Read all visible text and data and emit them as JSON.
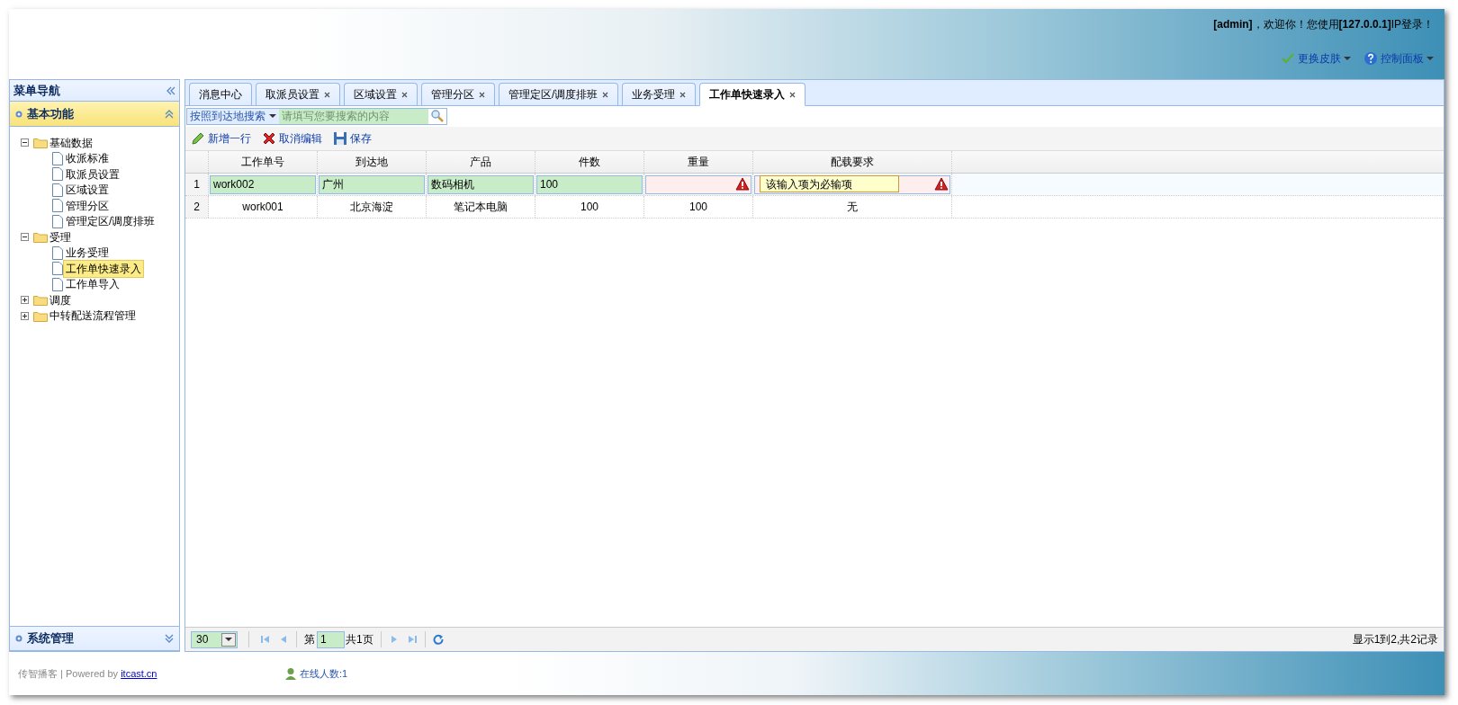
{
  "header": {
    "welcome": "**[admin]**，欢迎你！您使用**[127.0.0.1]**IP登录！",
    "menus": [
      {
        "kind": "skin",
        "label": "更换皮肤"
      },
      {
        "kind": "help",
        "label": "控制面板"
      }
    ]
  },
  "sidebar": {
    "title": "菜单导航",
    "sections": [
      {
        "title": "基本功能",
        "expanded": true,
        "tree": [
          {
            "label": "基础数据",
            "kind": "folder",
            "expanded": true,
            "children": [
              {
                "label": "收派标准",
                "kind": "file",
                "selected": false
              },
              {
                "label": "取派员设置",
                "kind": "file",
                "selected": false
              },
              {
                "label": "区域设置",
                "kind": "file",
                "selected": false
              },
              {
                "label": "管理分区",
                "kind": "file",
                "selected": false
              },
              {
                "label": "管理定区/调度排班",
                "kind": "file",
                "selected": false
              }
            ]
          },
          {
            "label": "受理",
            "kind": "folder",
            "expanded": true,
            "children": [
              {
                "label": "业务受理",
                "kind": "file",
                "selected": false
              },
              {
                "label": "工作单快速录入",
                "kind": "file",
                "selected": true
              },
              {
                "label": "工作单导入",
                "kind": "file",
                "selected": false
              }
            ]
          },
          {
            "label": "调度",
            "kind": "folder",
            "expanded": false
          },
          {
            "label": "中转配送流程管理",
            "kind": "folder",
            "expanded": false
          }
        ]
      },
      {
        "title": "系统管理",
        "expanded": false
      }
    ]
  },
  "tabs": [
    {
      "label": "消息中心",
      "closable": false,
      "selected": false
    },
    {
      "label": "取派员设置",
      "closable": true,
      "selected": false
    },
    {
      "label": "区域设置",
      "closable": true,
      "selected": false
    },
    {
      "label": "管理分区",
      "closable": true,
      "selected": false
    },
    {
      "label": "管理定区/调度排班",
      "closable": true,
      "selected": false
    },
    {
      "label": "业务受理",
      "closable": true,
      "selected": false
    },
    {
      "label": "工作单快速录入",
      "closable": true,
      "selected": true
    }
  ],
  "search": {
    "menu_label": "按照到达地搜索",
    "placeholder": "请填写您要搜索的内容"
  },
  "toolbar": [
    {
      "kind": "add",
      "label": "新增一行"
    },
    {
      "kind": "cancel",
      "label": "取消编辑"
    },
    {
      "kind": "save",
      "label": "保存"
    }
  ],
  "table": {
    "columns": [
      "工作单号",
      "到达地",
      "产品",
      "件数",
      "重量",
      "配载要求"
    ],
    "rows": [
      {
        "number": "1",
        "editing": true,
        "cells": [
          {
            "value": "work002",
            "invalid": false
          },
          {
            "value": "广州",
            "invalid": false
          },
          {
            "value": "数码相机",
            "invalid": false
          },
          {
            "value": "100",
            "invalid": false
          },
          {
            "invalid": true
          },
          {
            "invalid": true,
            "error_tip": "该输入项为必输项"
          }
        ]
      },
      {
        "number": "2",
        "editing": false,
        "cells": [
          {
            "value": "work001"
          },
          {
            "value": "北京海淀"
          },
          {
            "value": "笔记本电脑"
          },
          {
            "value": "100"
          },
          {
            "value": "100"
          },
          {
            "value": "无"
          }
        ]
      }
    ]
  },
  "pager": {
    "page_size": "30",
    "page_prefix": "第",
    "page": "1",
    "total_pages": "共1页",
    "summary": "显示1到2,共2记录"
  },
  "footer": {
    "credit": "传智播客 | Powered by ",
    "link": "itcast.cn",
    "online": "在线人数:1"
  }
}
